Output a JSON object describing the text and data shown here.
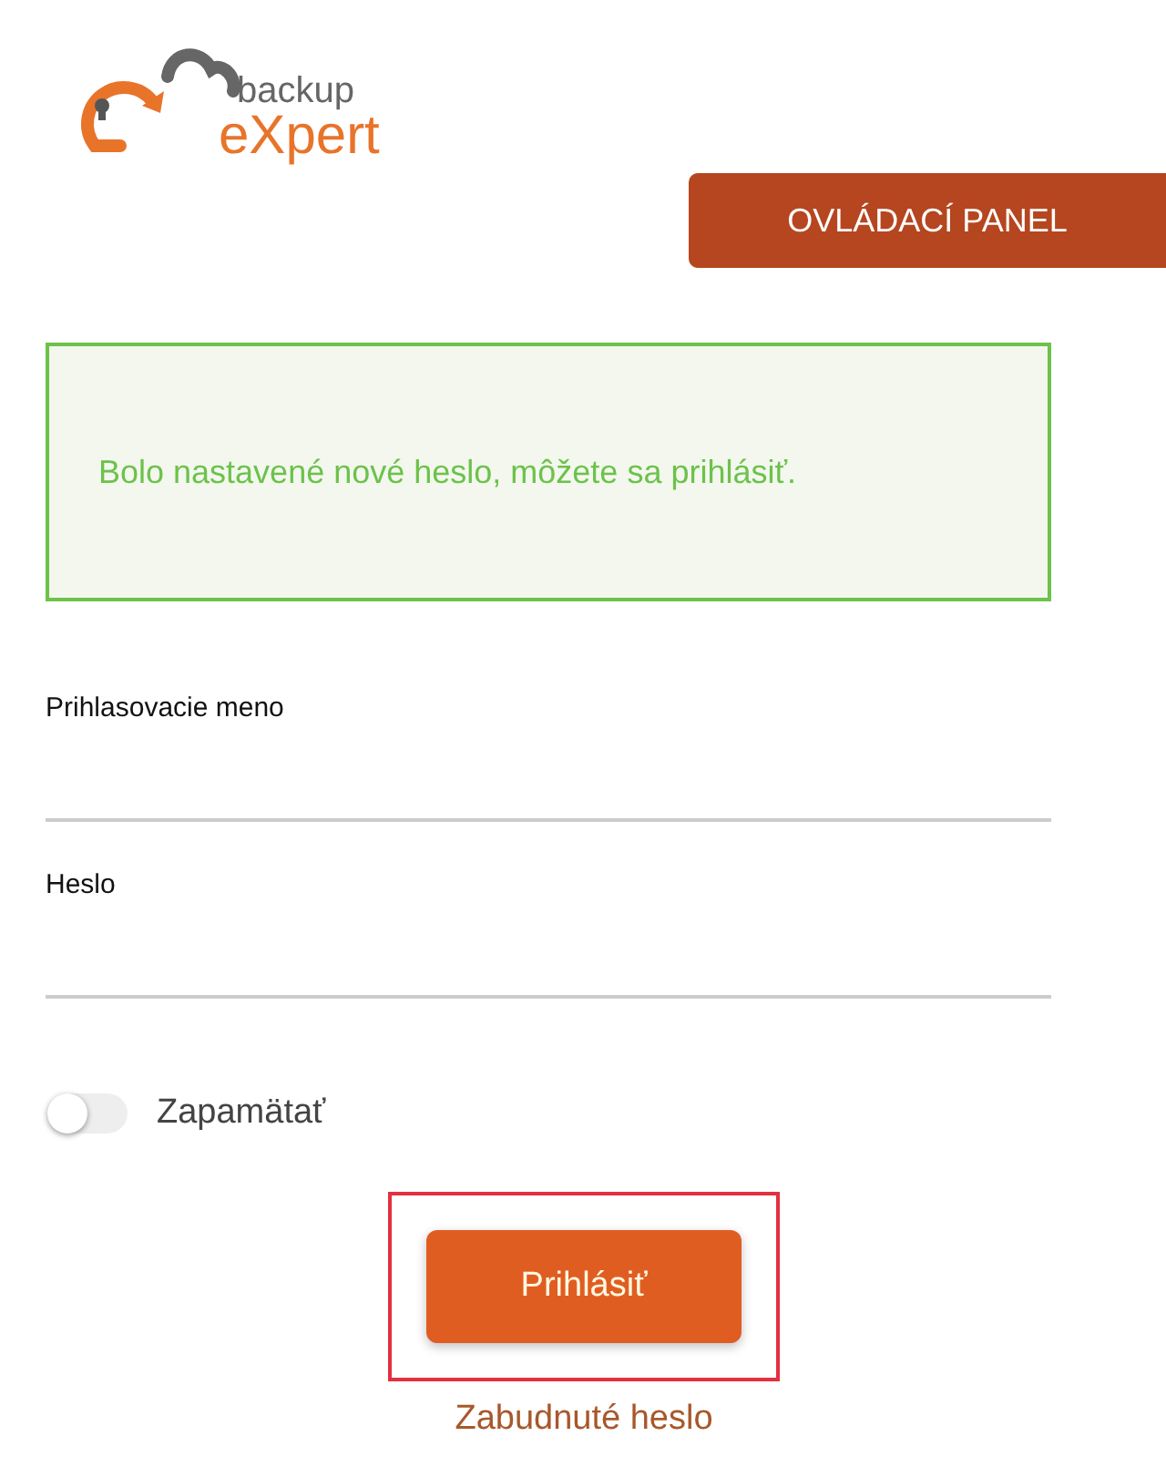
{
  "logo": {
    "word_top": "backup",
    "word_bottom": "eXpert"
  },
  "panel_button": {
    "label": "OVLÁDACÍ PANEL"
  },
  "alert": {
    "kind": "success",
    "message": "Bolo nastavené nové heslo, môžete sa prihlásiť."
  },
  "fields": [
    {
      "label": "Prihlasovacie meno"
    },
    {
      "label": "Heslo"
    }
  ],
  "remember": {
    "label": "Zapamätať",
    "on": false
  },
  "submit": {
    "label": "Prihlásiť",
    "highlighted": true
  },
  "forgot_link": "Zabudnuté heslo"
}
